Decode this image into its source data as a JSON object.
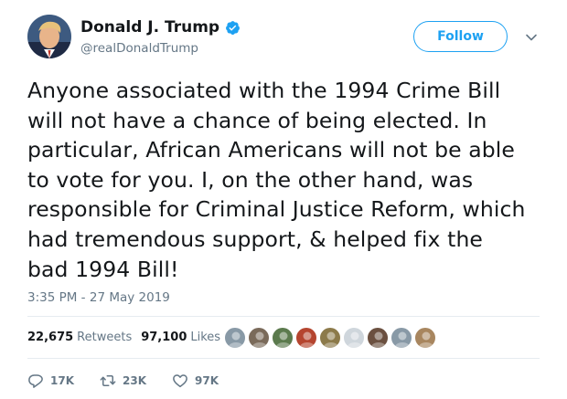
{
  "author": {
    "display_name": "Donald J. Trump",
    "handle": "@realDonaldTrump",
    "verified": true,
    "icons": {
      "avatar": "profile-photo",
      "verified": "verified-badge-icon"
    }
  },
  "follow_button": {
    "label": "Follow",
    "color": "#1da1f2"
  },
  "menu_icon": "chevron-down-icon",
  "tweet": {
    "text": "Anyone associated with the 1994 Crime Bill\nwill not have a chance of being elected. In\nparticular, African Americans will not be able\nto vote for you. I, on the other hand, was\nresponsible for Criminal Justice Reform, which\nhad tremendous support, & helped fix the\nbad 1994 Bill!",
    "timestamp": "3:35 PM - 27 May 2019"
  },
  "stats": {
    "retweets_count": "22,675",
    "retweets_label": "Retweets",
    "likes_count": "97,100",
    "likes_label": "Likes"
  },
  "liker_faces": [
    {
      "color": "#8899a6"
    },
    {
      "color": "#7a6a5a"
    },
    {
      "color": "#5b7a4d"
    },
    {
      "color": "#b5452f"
    },
    {
      "color": "#8c7a4a"
    },
    {
      "color": "#cfd6dc"
    },
    {
      "color": "#6b5040"
    },
    {
      "color": "#8899a6"
    },
    {
      "color": "#a8865f"
    }
  ],
  "actions": {
    "replies": "17K",
    "retweets": "23K",
    "likes": "97K",
    "icons": {
      "reply": "reply-icon",
      "retweet": "retweet-icon",
      "like": "heart-icon"
    }
  },
  "colors": {
    "text": "#14171a",
    "secondary": "#657786",
    "accent": "#1da1f2",
    "divider": "#e6ecf0"
  }
}
